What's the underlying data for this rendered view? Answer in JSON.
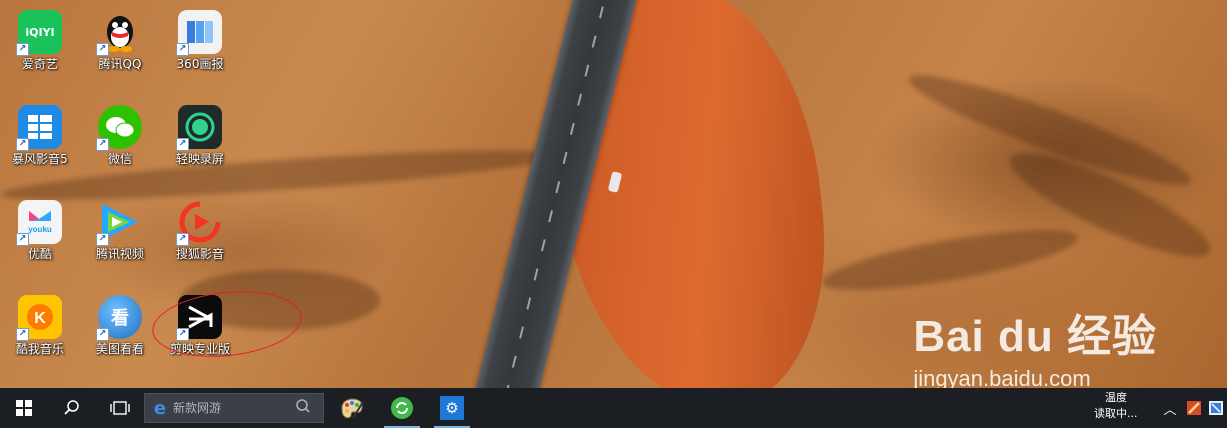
{
  "desktop": {
    "icons": [
      {
        "label": "爱奇艺",
        "glyph": "iQIYI",
        "color": "#19c25a",
        "name": "iqiyi-icon"
      },
      {
        "label": "腾讯QQ",
        "glyph": "🐧",
        "color": "transparent",
        "name": "qq-icon"
      },
      {
        "label": "360画报",
        "glyph": "",
        "color": "#f2f2f2",
        "name": "360-pictorial-icon"
      },
      {
        "label": "暴风影音5",
        "glyph": "▦",
        "color": "#1d8ae6",
        "name": "baofeng-icon"
      },
      {
        "label": "微信",
        "glyph": "💬",
        "color": "#2dc100",
        "name": "wechat-icon"
      },
      {
        "label": "轻映录屏",
        "glyph": "◉",
        "color": "#1f2b2a",
        "name": "screen-recorder-icon"
      },
      {
        "label": "优酷",
        "glyph": "youku",
        "color": "#f4f4f4",
        "name": "youku-icon"
      },
      {
        "label": "腾讯视频",
        "glyph": "▶",
        "color": "transparent",
        "name": "tencent-video-icon"
      },
      {
        "label": "搜狐影音",
        "glyph": "▶",
        "color": "transparent",
        "name": "sohu-video-icon"
      },
      {
        "label": "酷我音乐",
        "glyph": "K",
        "color": "#ffc400",
        "name": "kuwo-music-icon"
      },
      {
        "label": "美图看看",
        "glyph": "看",
        "color": "#1f7fd6",
        "name": "meitu-viewer-icon"
      },
      {
        "label": "剪映专业版",
        "glyph": "✂",
        "color": "#0b0b0b",
        "name": "jianying-pro-icon"
      }
    ]
  },
  "watermark": {
    "logo": "Bai du 经验",
    "site": "jingyan.baidu.com"
  },
  "taskbar": {
    "search_placeholder": "新款网游",
    "weather_line1": "温度",
    "weather_line2": "读取中..."
  }
}
